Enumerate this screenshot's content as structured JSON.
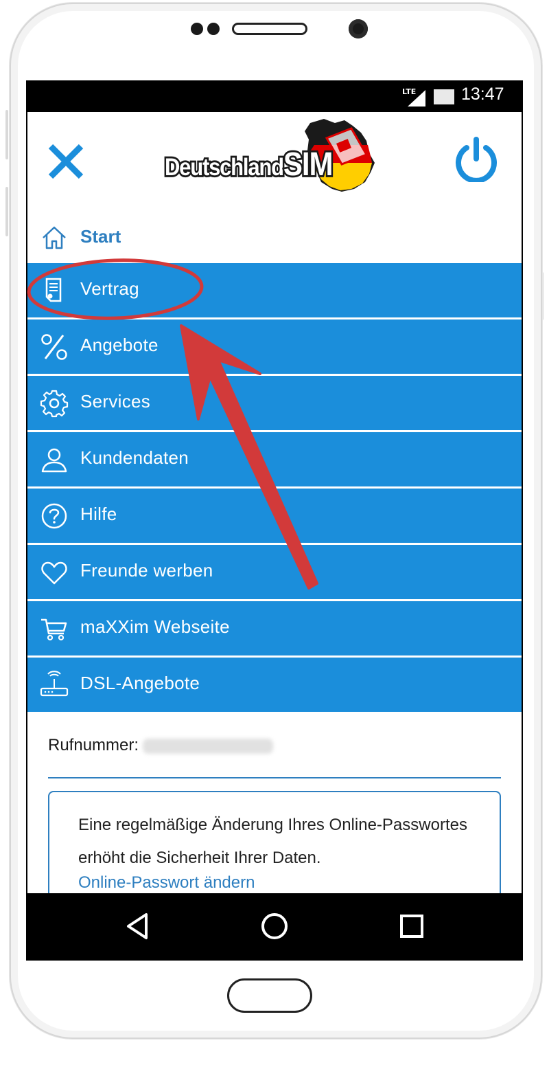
{
  "status_bar": {
    "network": "LTE",
    "time": "13:47"
  },
  "header": {
    "logo_text_small": "Deutschland",
    "logo_text_big": "SIM",
    "logo_colors": {
      "black": "#1a1a1a",
      "red": "#dd0000",
      "gold": "#ffce00"
    }
  },
  "start": {
    "label": "Start",
    "icon": "home-icon"
  },
  "menu": {
    "items": [
      {
        "label": "Vertrag",
        "icon": "contract-icon"
      },
      {
        "label": "Angebote",
        "icon": "percent-icon"
      },
      {
        "label": "Services",
        "icon": "gear-icon"
      },
      {
        "label": "Kundendaten",
        "icon": "user-icon"
      },
      {
        "label": "Hilfe",
        "icon": "help-icon"
      },
      {
        "label": "Freunde werben",
        "icon": "heart-icon"
      },
      {
        "label": "maXXim Webseite",
        "icon": "cart-icon"
      },
      {
        "label": "DSL-Angebote",
        "icon": "router-icon"
      }
    ]
  },
  "account": {
    "phone_label": "Rufnummer:",
    "info_text": "Eine regelmäßige Änderung Ihres Online-Passwortes erhöht die Sicherheit Ihrer Daten.",
    "info_link": "Online-Passwort ändern"
  },
  "colors": {
    "menu_bg": "#1b8edb",
    "accent": "#2e7fc0",
    "annotation": "#d23a3a"
  }
}
